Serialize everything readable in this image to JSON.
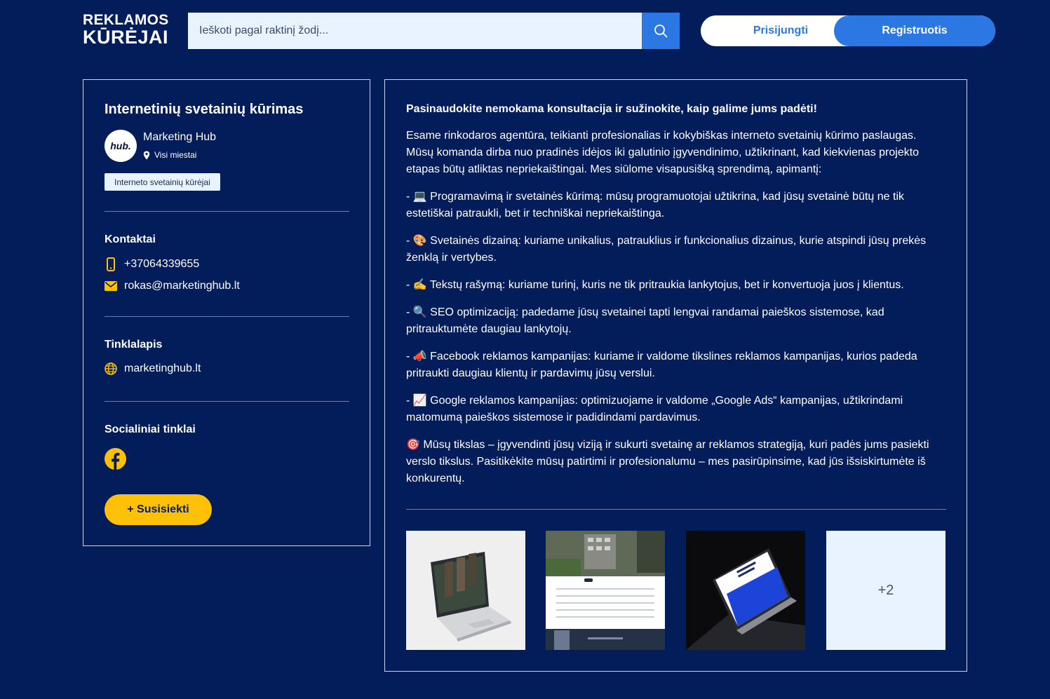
{
  "header": {
    "logo_line1": "REKLAMOS",
    "logo_line2": "KŪRĖJAI",
    "search_placeholder": "Ieškoti pagal raktinį žodį...",
    "login_label": "Prisijungti",
    "register_label": "Registruotis"
  },
  "profile": {
    "title": "Internetinių svetainių kūrimas",
    "avatar_text": "hub.",
    "company": "Marketing Hub",
    "location": "Visi miestai",
    "tag": "Interneto svetainių kūrėjai",
    "contacts_title": "Kontaktai",
    "phone": "+37064339655",
    "email": "rokas@marketinghub.lt",
    "website_title": "Tinklalapis",
    "website": "marketinghub.lt",
    "social_title": "Socialiniai tinklai",
    "contact_button": "+ Susisiekti"
  },
  "description": {
    "lead": "Pasinaudokite nemokama konsultacija ir sužinokite, kaip galime jums padėti!",
    "intro": "Esame rinkodaros agentūra, teikianti profesionalias ir kokybiškas interneto svetainių kūrimo paslaugas. Mūsų komanda dirba nuo pradinės idėjos iki galutinio įgyvendinimo, užtikrinant, kad kiekvienas projekto etapas būtų atliktas nepriekaištingai. Mes siūlome visapusišką sprendimą, apimantį:",
    "items": [
      "- 💻 Programavimą ir svetainės kūrimą: mūsų programuotojai užtikrina, kad jūsų svetainė būtų ne tik estetiškai patraukli, bet ir techniškai nepriekaištinga.",
      "- 🎨 Svetainės dizainą: kuriame unikalius, patrauklius ir funkcionalius dizainus, kurie atspindi jūsų prekės ženklą ir vertybes.",
      "- ✍️ Tekstų rašymą: kuriame turinį, kuris ne tik pritraukia lankytojus, bet ir konvertuoja juos į klientus.",
      "- 🔍 SEO optimizaciją: padedame jūsų svetainei tapti lengvai randamai paieškos sistemose, kad pritrauktumėte daugiau lankytojų.",
      "- 📣 Facebook reklamos kampanijas: kuriame ir valdome tikslines reklamos kampanijas, kurios padeda pritraukti daugiau klientų ir pardavimų jūsų verslui.",
      "- 📈 Google reklamos kampanijas: optimizuojame ir valdome „Google Ads“ kampanijas, užtikrindami matomumą paieškos sistemose ir padidindami pardavimus."
    ],
    "outro": "🎯 Mūsų tikslas – įgyvendinti jūsų viziją ir sukurti svetainę ar reklamos strategiją, kuri padės jums pasiekti verslo tikslus. Pasitikėkite mūsų patirtimi ir profesionalumu – mes pasirūpinsime, kad jūs išsiskirtumėte iš konkurentų."
  },
  "gallery": {
    "more_label": "+2"
  },
  "colors": {
    "background": "#031c5a",
    "accent_blue": "#2b78e4",
    "accent_yellow": "#ffc107",
    "light_fill": "#e8f3ff"
  }
}
